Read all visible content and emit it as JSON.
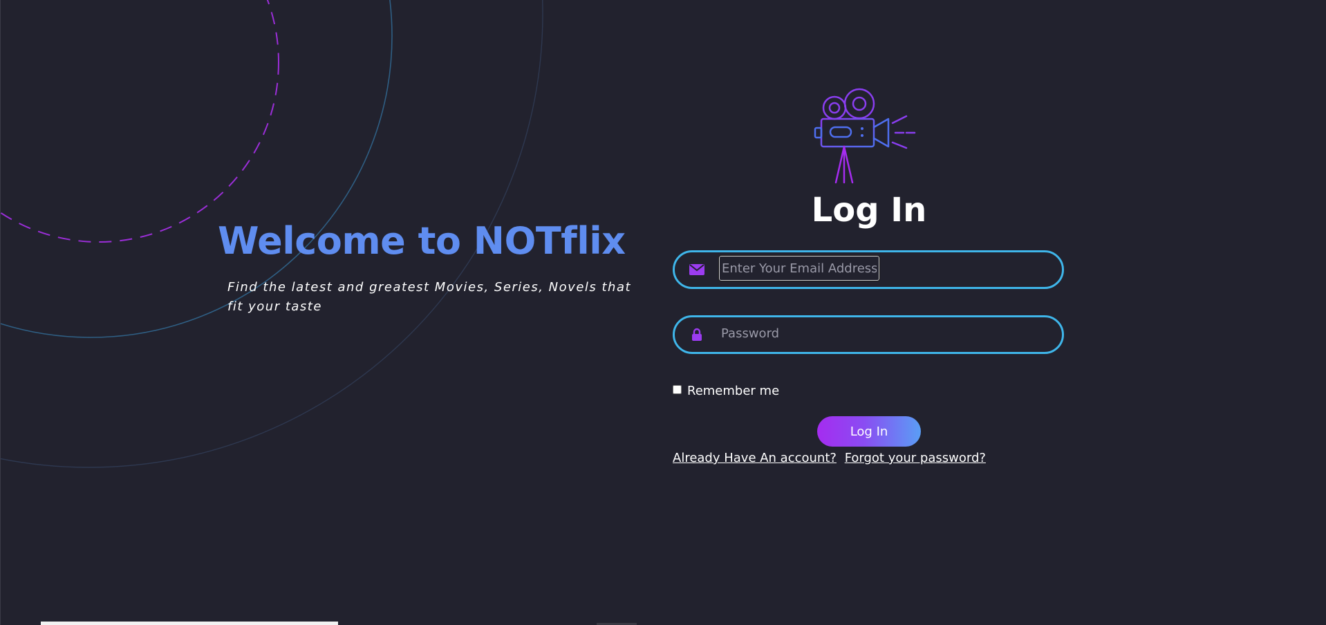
{
  "colors": {
    "background": "#22222e",
    "accent_blue": "#5f8df0",
    "field_border": "#3fb6ea",
    "icon_purple": "#9b3cf0",
    "button_gradient_start": "#a52cf0",
    "button_gradient_end": "#5a9ef5"
  },
  "hero": {
    "title": "Welcome to NOTflix",
    "tagline": "Find the latest and greatest Movies, Series,  Novels that fit your taste"
  },
  "login": {
    "logo_icon": "film-camera-icon",
    "title": "Log In",
    "email": {
      "icon": "envelope-icon",
      "value": "",
      "placeholder": "Enter Your Email Address"
    },
    "password": {
      "icon": "lock-icon",
      "value": "",
      "placeholder": "Password"
    },
    "remember_label": "Remember me",
    "remember_checked": false,
    "submit_label": "Log In",
    "links": {
      "account": "Already Have An account?",
      "forgot": "Forgot your password?"
    }
  }
}
